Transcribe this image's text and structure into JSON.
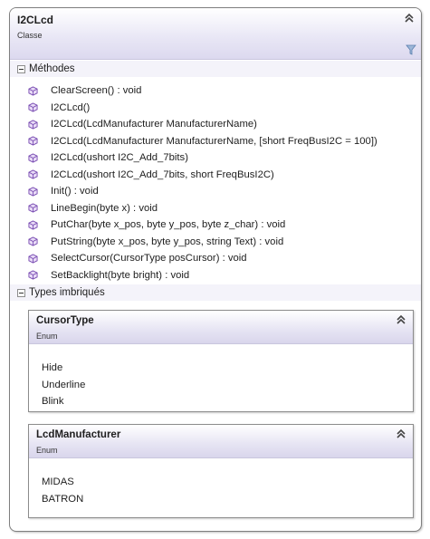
{
  "class": {
    "name": "I2CLcd",
    "stereotype": "Classe",
    "icons": {
      "collapse": "double-chevron-up-icon",
      "filter": "filter-icon"
    },
    "methods_section": {
      "label": "Méthodes",
      "icon": "method-cube-icon",
      "items": [
        "ClearScreen() : void",
        "I2CLcd()",
        "I2CLcd(LcdManufacturer ManufacturerName)",
        "I2CLcd(LcdManufacturer ManufacturerName, [short FreqBusI2C = 100])",
        "I2CLcd(ushort I2C_Add_7bits)",
        "I2CLcd(ushort I2C_Add_7bits, short FreqBusI2C)",
        "Init() : void",
        "LineBegin(byte x) : void",
        "PutChar(byte x_pos, byte y_pos, byte z_char) : void",
        "PutString(byte x_pos, byte y_pos, string Text) : void",
        "SelectCursor(CursorType posCursor) : void",
        "SetBacklight(byte bright) : void"
      ]
    },
    "nested_section": {
      "label": "Types imbriqués",
      "types": [
        {
          "name": "CursorType",
          "stereotype": "Enum",
          "values": [
            "Hide",
            "Underline",
            "Blink"
          ]
        },
        {
          "name": "LcdManufacturer",
          "stereotype": "Enum",
          "values": [
            "MIDAS",
            "BATRON"
          ]
        }
      ]
    }
  },
  "colors": {
    "header_gradient_end": "#dcd9ef",
    "method_icon": "#7b4fb3",
    "border": "#7f7f7f"
  }
}
